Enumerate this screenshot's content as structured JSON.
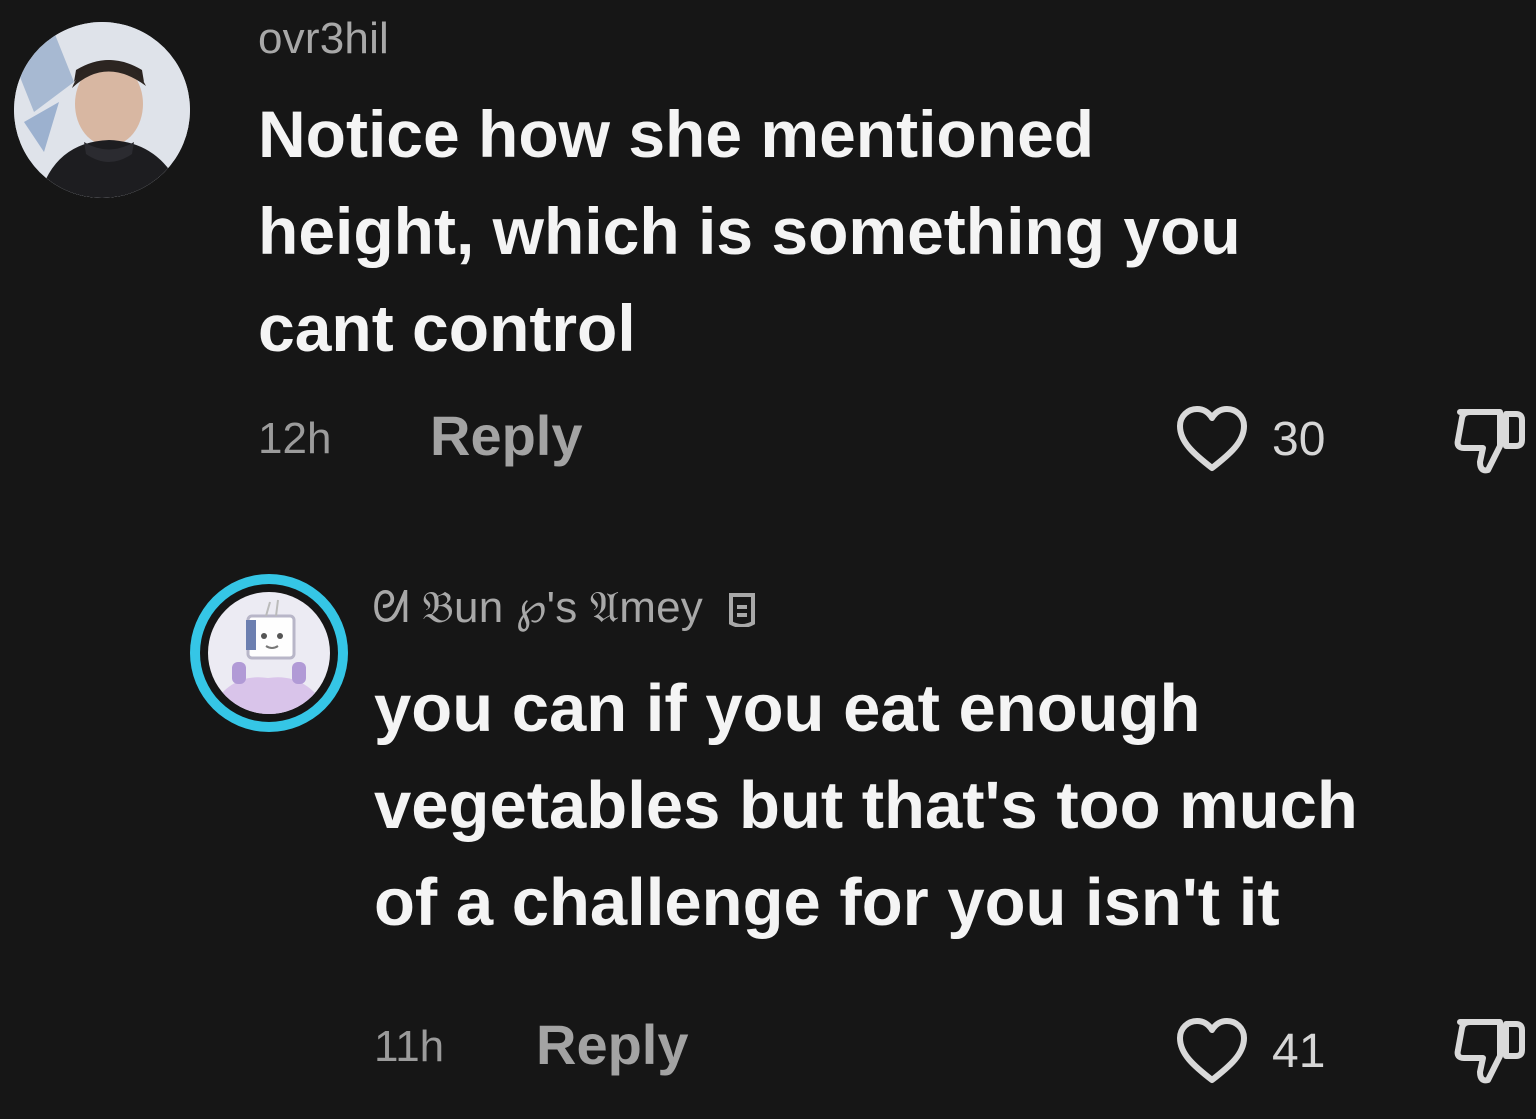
{
  "comments": [
    {
      "username": "ovr3hil",
      "text": "Notice how she mentioned\nheight, which is something you\ncant control",
      "time": "12h",
      "reply_label": "Reply",
      "likes": "30",
      "avatar_icon": "profile-photo"
    },
    {
      "username": "ᘛ 𝔅un ℘'s 𝔄mey",
      "text": "you can if you eat enough\nvegetables but that's too much\nof a challenge for you isn't it",
      "time": "11h",
      "reply_label": "Reply",
      "likes": "41",
      "avatar_icon": "cartoon-avatar",
      "avatar_ring_color": "#35c6e6"
    }
  ],
  "icons": {
    "like": "heart-outline-icon",
    "dislike": "thumbs-down-icon"
  }
}
